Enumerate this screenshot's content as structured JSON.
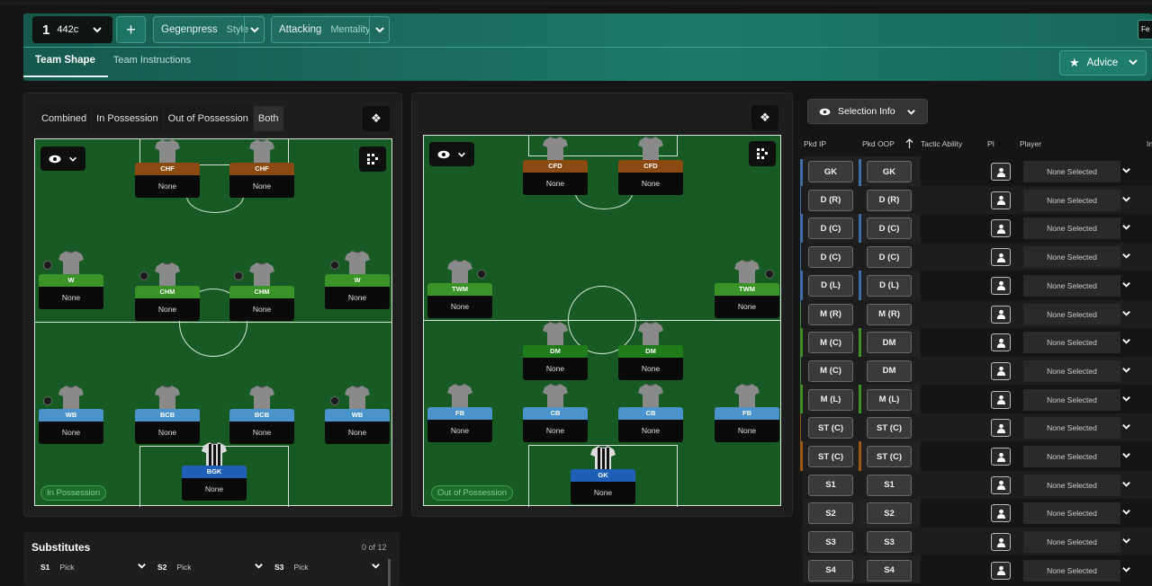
{
  "header": {
    "formation_num": "1",
    "formation": "442c",
    "plus": "+",
    "style_value": "Gegenpress",
    "style_label": "Style",
    "mentality_value": "Attacking",
    "mentality_label": "Mentality",
    "tab_shape": "Team Shape",
    "tab_instructions": "Team Instructions",
    "advice": "Advice",
    "cut_button": "Fe"
  },
  "view_modes": [
    "Combined",
    "In Possession",
    "Out of Possession",
    "Both"
  ],
  "left_pitch": {
    "tag": "In Possession",
    "players": [
      {
        "role": "CHF",
        "name": "None"
      },
      {
        "role": "CHF",
        "name": "None"
      },
      {
        "role": "W",
        "name": "None"
      },
      {
        "role": "CHM",
        "name": "None"
      },
      {
        "role": "CHM",
        "name": "None"
      },
      {
        "role": "W",
        "name": "None"
      },
      {
        "role": "WB",
        "name": "None"
      },
      {
        "role": "BCB",
        "name": "None"
      },
      {
        "role": "BCB",
        "name": "None"
      },
      {
        "role": "WB",
        "name": "None"
      },
      {
        "role": "BGK",
        "name": "None"
      }
    ]
  },
  "right_pitch": {
    "tag": "Out of Possession",
    "players": [
      {
        "role": "CFD",
        "name": "None"
      },
      {
        "role": "CFD",
        "name": "None"
      },
      {
        "role": "TWM",
        "name": "None"
      },
      {
        "role": "TWM",
        "name": "None"
      },
      {
        "role": "DM",
        "name": "None"
      },
      {
        "role": "DM",
        "name": "None"
      },
      {
        "role": "FB",
        "name": "None"
      },
      {
        "role": "CB",
        "name": "None"
      },
      {
        "role": "CB",
        "name": "None"
      },
      {
        "role": "FB",
        "name": "None"
      },
      {
        "role": "GK",
        "name": "None"
      }
    ]
  },
  "selection": {
    "button": "Selection Info",
    "columns": {
      "ip": "Pkd IP",
      "oop": "Pkd OOP",
      "tactic": "Tactic Ability",
      "pi": "PI",
      "player": "Player",
      "cut": "In"
    },
    "rows": [
      {
        "ip": "GK",
        "oop": "GK",
        "player": "None Selected"
      },
      {
        "ip": "D (R)",
        "oop": "D (R)",
        "player": "None Selected"
      },
      {
        "ip": "D (C)",
        "oop": "D (C)",
        "player": "None Selected"
      },
      {
        "ip": "D (C)",
        "oop": "D (C)",
        "player": "None Selected"
      },
      {
        "ip": "D (L)",
        "oop": "D (L)",
        "player": "None Selected"
      },
      {
        "ip": "M (R)",
        "oop": "M (R)",
        "player": "None Selected"
      },
      {
        "ip": "M (C)",
        "oop": "DM",
        "player": "None Selected"
      },
      {
        "ip": "M (C)",
        "oop": "DM",
        "player": "None Selected"
      },
      {
        "ip": "M (L)",
        "oop": "M (L)",
        "player": "None Selected"
      },
      {
        "ip": "ST (C)",
        "oop": "ST (C)",
        "player": "None Selected"
      },
      {
        "ip": "ST (C)",
        "oop": "ST (C)",
        "player": "None Selected"
      },
      {
        "ip": "S1",
        "oop": "S1",
        "player": "None Selected"
      },
      {
        "ip": "S2",
        "oop": "S2",
        "player": "None Selected"
      },
      {
        "ip": "S3",
        "oop": "S3",
        "player": "None Selected"
      },
      {
        "ip": "S4",
        "oop": "S4",
        "player": "None Selected"
      }
    ]
  },
  "substitutes": {
    "title": "Substitutes",
    "count": "0 of 12",
    "slots": [
      {
        "label": "S1",
        "value": "Pick"
      },
      {
        "label": "S2",
        "value": "Pick"
      },
      {
        "label": "S3",
        "value": "Pick"
      }
    ]
  },
  "colors": {
    "header": "#1d7a68",
    "pitch": "#175a24",
    "attack": "#8b4a12",
    "midfield": "#3a9326",
    "defence": "#4a93cc",
    "goalkeeper": "#1e5fb8"
  }
}
